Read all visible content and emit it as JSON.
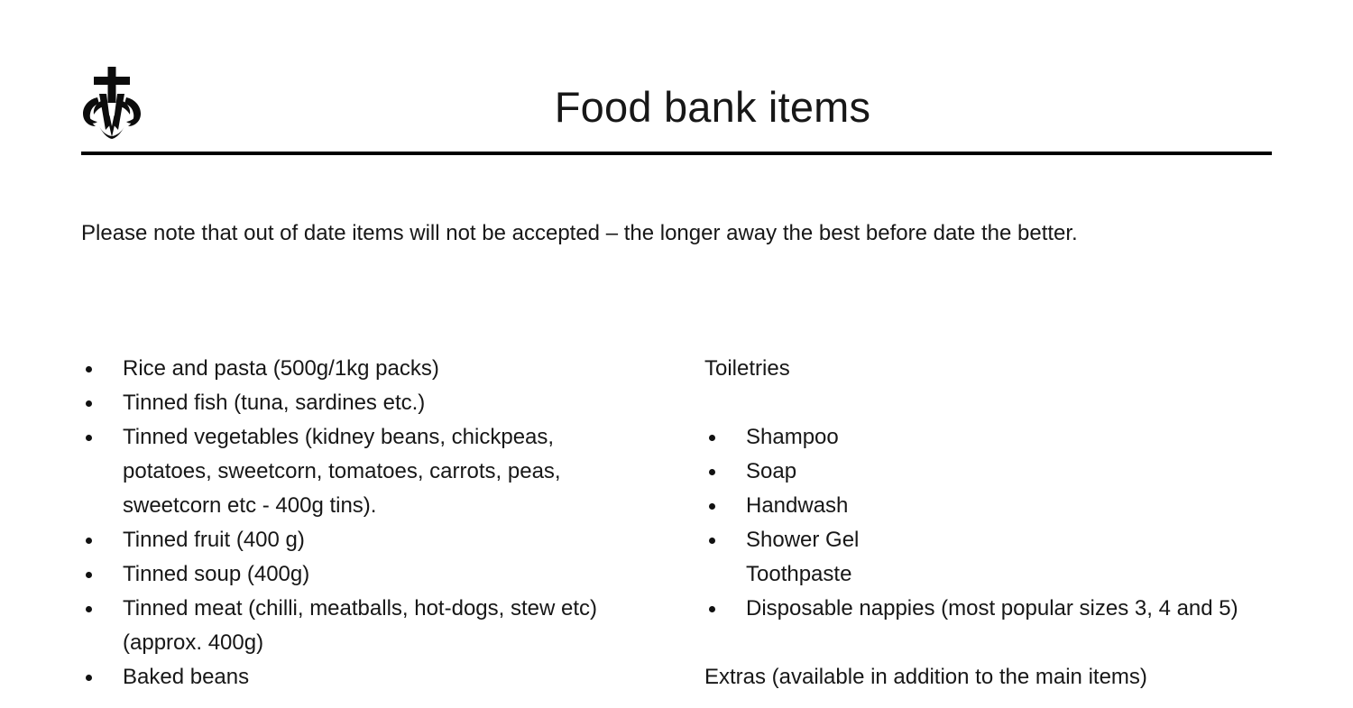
{
  "document": {
    "title": "Food bank items",
    "background_color": "#ffffff",
    "text_color": "#171717",
    "rule_color": "#000000"
  },
  "header": {
    "logo_name": "marian-cross-monogram-logo",
    "title": "Food bank items"
  },
  "intro": {
    "text": "Please note that out of date items will not be accepted – the longer away the best before date the better."
  },
  "columns": {
    "left": {
      "heading": "",
      "items": [
        {
          "text": "Rice and pasta (500g/1kg packs)",
          "bulleted": true
        },
        {
          "text": "Tinned fish (tuna, sardines etc.)",
          "bulleted": true
        },
        {
          "text": "Tinned vegetables (kidney beans, chickpeas, potatoes, sweetcorn, tomatoes, carrots, peas, sweetcorn etc - 400g tins).",
          "bulleted": true
        },
        {
          "text": "Tinned fruit (400 g)",
          "bulleted": true
        },
        {
          "text": "Tinned soup (400g)",
          "bulleted": true
        },
        {
          "text": "Tinned meat (chilli, meatballs, hot-dogs, stew etc) (approx. 400g)",
          "bulleted": true
        },
        {
          "text": "Baked beans",
          "bulleted": true
        }
      ]
    },
    "right": {
      "heading": "Toiletries",
      "items": [
        {
          "text": "Shampoo",
          "bulleted": true
        },
        {
          "text": "Soap",
          "bulleted": true
        },
        {
          "text": "Handwash",
          "bulleted": true
        },
        {
          "text": "Shower Gel",
          "bulleted": true
        },
        {
          "text": "Toothpaste",
          "bulleted": false
        },
        {
          "text": "Disposable nappies (most popular sizes 3, 4 and 5)",
          "bulleted": true
        }
      ],
      "trailing_heading": "Extras (available in addition to the main items)"
    }
  }
}
